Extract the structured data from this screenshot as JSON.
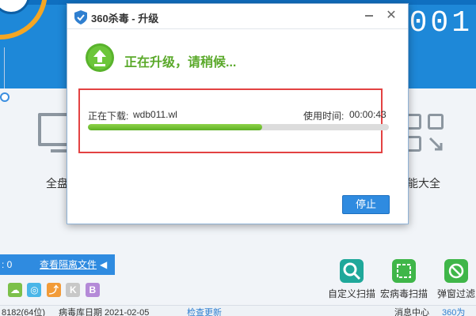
{
  "dialog": {
    "title": "360杀毒 - 升级",
    "heading": "正在升级，请稍候...",
    "download_label": "正在下载:",
    "file_name": "wdb011.wl",
    "time_label": "使用时间:",
    "time_value": "00:00:43",
    "progress": 0.58,
    "stop_label": "停止",
    "close_glyph": "✕"
  },
  "background": {
    "header_text": "...",
    "digits": "0001",
    "tile_left_label": "全盘",
    "tile_right_label": "能大全",
    "quarantine_count": ": 0",
    "quarantine_link": "查看隔离文件",
    "quarantine_arrow": "◀",
    "engines": [
      "☁",
      "◎",
      "⤴",
      "K",
      "B"
    ],
    "tools": [
      "自定义扫描",
      "宏病毒扫描",
      "弹窗过滤"
    ],
    "status": {
      "version": "8182(64位)",
      "db_date": "病毒库日期 2021-02-05",
      "check_update": "检查更新",
      "msg_center": "消息中心",
      "brand": "360为"
    }
  },
  "colors": {
    "accent_blue": "#2f8be0",
    "progress_green": "#5db024",
    "highlight_red": "#e34242",
    "heading_green": "#5aa92a"
  }
}
